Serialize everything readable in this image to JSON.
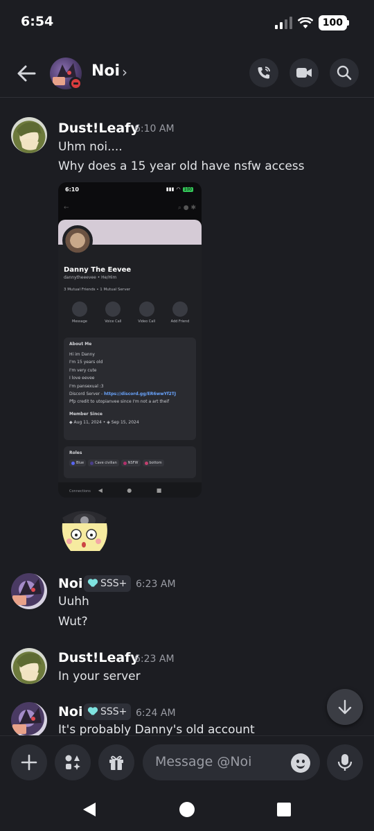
{
  "status_bar": {
    "time": "6:54",
    "battery": "100"
  },
  "header": {
    "title": "Noi"
  },
  "messages": [
    {
      "author": "Dust!Leafy",
      "time": "6:10 AM",
      "lines": [
        "Uhm noi....",
        "Why does a 15 year old have nsfw access"
      ]
    },
    {
      "author": "Noi",
      "tag": "SSS+",
      "time": "6:23 AM",
      "lines": [
        "Uuhh",
        "Wut?"
      ]
    },
    {
      "author": "Dust!Leafy",
      "time": "6:23 AM",
      "lines": [
        "In your server"
      ]
    },
    {
      "author": "Noi",
      "tag": "SSS+",
      "time": "6:24 AM",
      "lines": [
        "It's probably Danny's old account"
      ]
    }
  ],
  "attachment": {
    "status_time": "6:10",
    "battery": "100",
    "profile_name": "Danny The Eevee",
    "profile_sub": "dannytheeevee • He/Him",
    "mutuals": "3 Mutual Friends  •  1 Mutual Server",
    "actions": [
      "Message",
      "Voice Call",
      "Video Call",
      "Add Friend"
    ],
    "about_title": "About Me",
    "about_lines": [
      "Hi im Danny",
      "I'm 15 years old",
      "I'm very cute",
      "I love eevee",
      "I'm pansexual :3"
    ],
    "discord_label": "Discord Server - ",
    "discord_link": "https://discord.gg/ER6wwYf2TJ",
    "credit_line": "Pfp credit to utopianvee since I'm not a art theif",
    "member_since_title": "Member Since",
    "member_since_discord": "Aug 11, 2024",
    "member_since_server": "Sep 15, 2024",
    "roles_title": "Roles",
    "roles": [
      {
        "name": "Blue",
        "color": "#5865f2"
      },
      {
        "name": "Cave civilian",
        "color": "#4a3f8a"
      },
      {
        "name": "NSFW",
        "color": "#b0306a"
      },
      {
        "name": "bottom",
        "color": "#c2406e"
      }
    ],
    "connections_label": "Connections"
  },
  "composer": {
    "placeholder": "Message @Noi"
  },
  "icons": {
    "back": "arrow-left-icon",
    "call": "phone-icon",
    "video": "video-icon",
    "search": "search-icon",
    "add": "plus-icon",
    "apps": "apps-icon",
    "gift": "gift-icon",
    "emoji": "emoji-icon",
    "mic": "mic-icon",
    "jump": "arrow-down-icon"
  },
  "colors": {
    "background": "#1c1d22",
    "tag_heart": "#7fe3e0",
    "dnd": "#d83c3e",
    "link": "#6aa5ff"
  }
}
